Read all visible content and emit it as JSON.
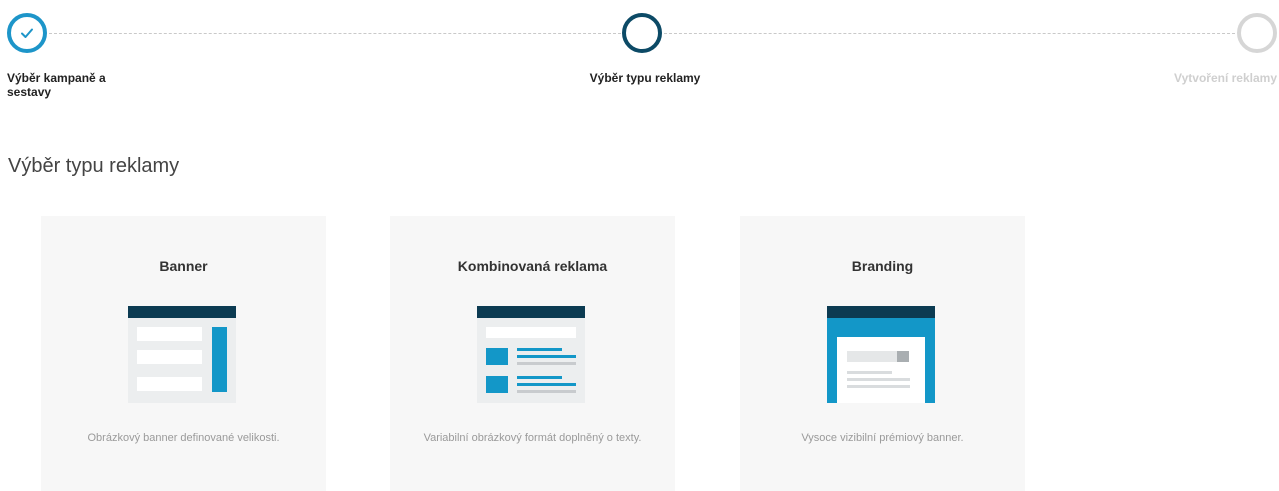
{
  "stepper": {
    "steps": [
      {
        "label": "Výběr kampaně a sestavy",
        "state": "completed"
      },
      {
        "label": "Výběr typu reklamy",
        "state": "active"
      },
      {
        "label": "Vytvoření reklamy",
        "state": "upcoming"
      }
    ],
    "icons": {
      "completed": "checkmark-icon"
    }
  },
  "page": {
    "heading": "Výběr typu reklamy"
  },
  "ad_types": [
    {
      "title": "Banner",
      "description": "Obrázkový banner definované velikosti.",
      "icon": "banner-illustration-icon"
    },
    {
      "title": "Kombinovaná reklama",
      "description": "Variabilní obrázkový formát doplněný o texty.",
      "icon": "combined-ad-illustration-icon"
    },
    {
      "title": "Branding",
      "description": "Vysoce vizibilní prémiový banner.",
      "icon": "branding-illustration-icon"
    }
  ],
  "colors": {
    "dark_navy": "#0c3b52",
    "accent_blue": "#1397c8",
    "active_ring": "#0c4a66",
    "inactive_ring": "#d6d6d6",
    "card_bg": "#f7f7f7"
  }
}
